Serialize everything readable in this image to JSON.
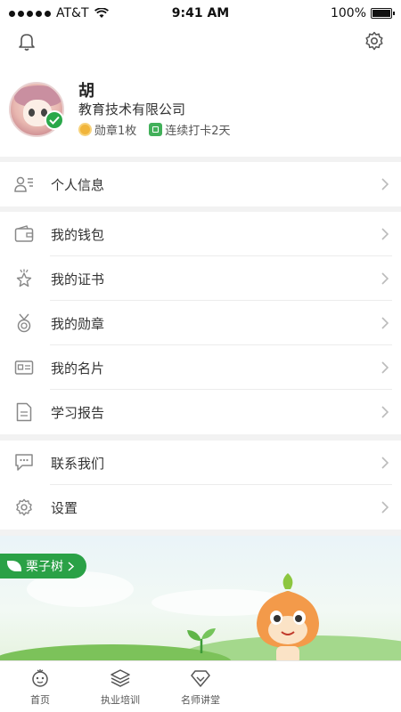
{
  "status_bar": {
    "carrier": "AT&T",
    "time": "9:41 AM",
    "battery": "100%"
  },
  "profile": {
    "name": "胡",
    "company": "教育技术有限公司",
    "medal_stat": "勋章1枚",
    "checkin_stat": "连续打卡2天",
    "verified_icon": "check-icon"
  },
  "menu": {
    "personal_info": "个人信息",
    "wallet": "我的钱包",
    "certificate": "我的证书",
    "medal": "我的勋章",
    "business_card": "我的名片",
    "study_report": "学习报告",
    "contact": "联系我们",
    "settings": "设置"
  },
  "banner": {
    "brand": "栗子树"
  },
  "tabs": [
    {
      "label": "首页",
      "icon": "home-icon"
    },
    {
      "label": "执业培训",
      "icon": "layers-icon"
    },
    {
      "label": "名师讲堂",
      "icon": "diamond-icon"
    }
  ],
  "colors": {
    "accent": "#2aa146",
    "background": "#f2f2f2"
  }
}
